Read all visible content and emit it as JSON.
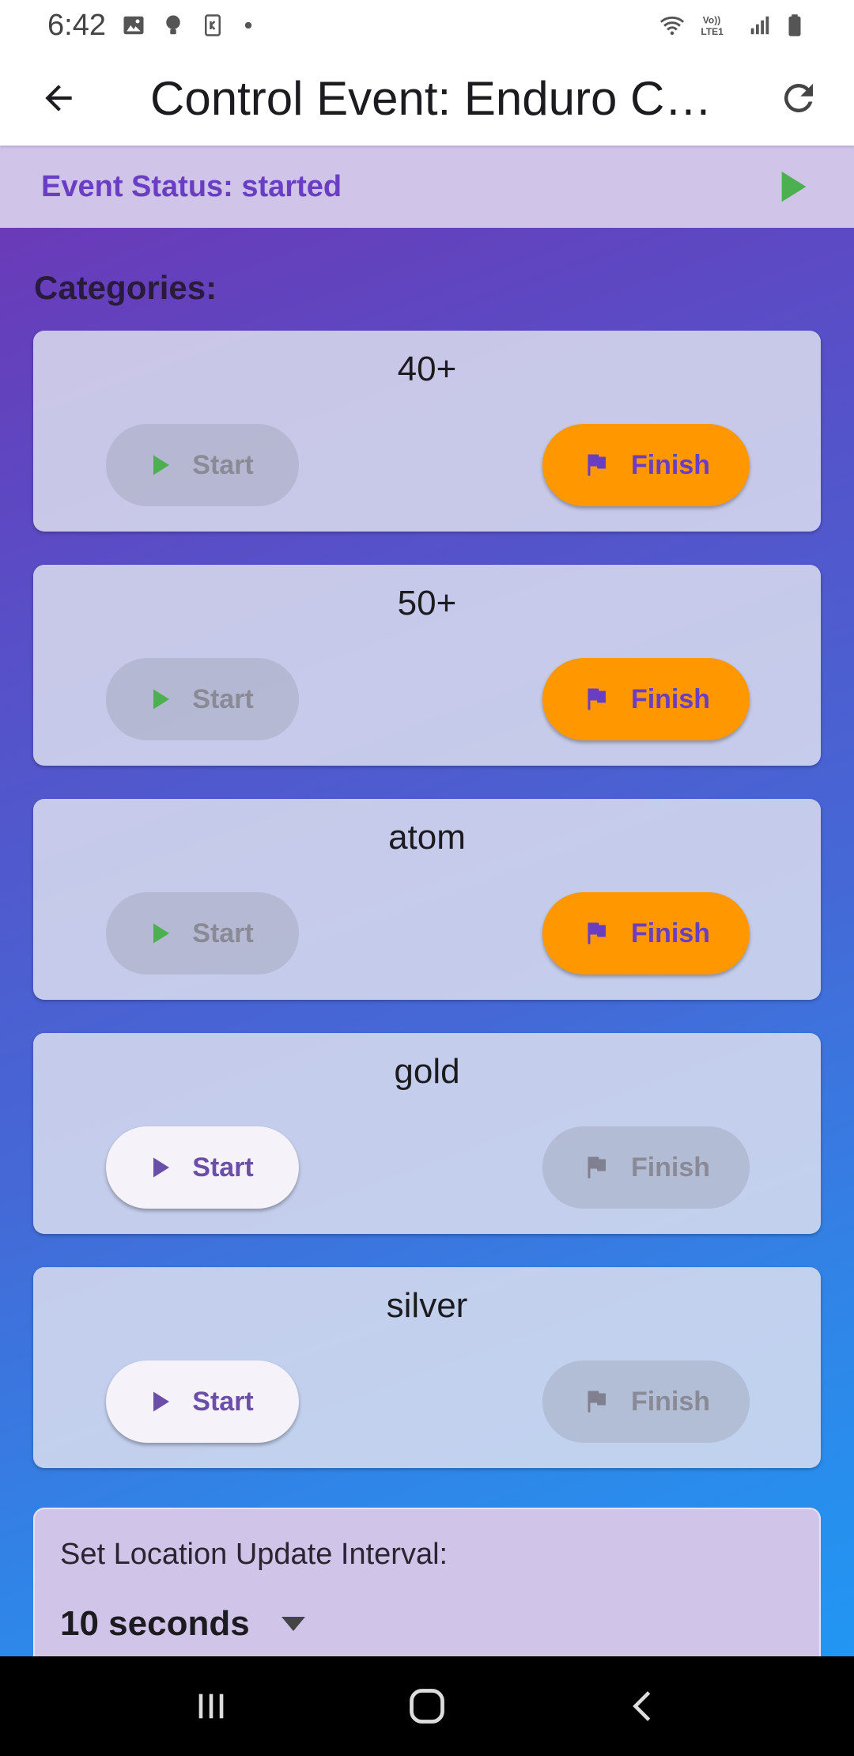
{
  "status_bar": {
    "time": "6:42",
    "icons_left": [
      "image-icon",
      "bulb-icon",
      "k-icon",
      "dot-icon"
    ],
    "icons_right": [
      "wifi-icon",
      "volte-icon",
      "signal-icon",
      "battery-icon"
    ],
    "volte_label": "Vo))\nLTE1"
  },
  "app_bar": {
    "title": "Control Event: Enduro Championship",
    "back_icon": "arrow-left-icon",
    "refresh_icon": "refresh-icon"
  },
  "event_status": {
    "text": "Event Status: started",
    "action_icon": "play-icon",
    "action_color": "#4caf50"
  },
  "categories": {
    "heading": "Categories:",
    "items": [
      {
        "name": "40+",
        "start_label": "Start",
        "finish_label": "Finish",
        "start_enabled": false,
        "finish_enabled": true
      },
      {
        "name": "50+",
        "start_label": "Start",
        "finish_label": "Finish",
        "start_enabled": false,
        "finish_enabled": true
      },
      {
        "name": "atom",
        "start_label": "Start",
        "finish_label": "Finish",
        "start_enabled": false,
        "finish_enabled": true
      },
      {
        "name": "gold",
        "start_label": "Start",
        "finish_label": "Finish",
        "start_enabled": true,
        "finish_enabled": false
      },
      {
        "name": "silver",
        "start_label": "Start",
        "finish_label": "Finish",
        "start_enabled": true,
        "finish_enabled": false
      }
    ]
  },
  "location_interval": {
    "label": "Set Location Update Interval:",
    "selected": "10 seconds"
  },
  "colors": {
    "accent": "#6a3ec2",
    "finish_active": "#ff9800",
    "start_disabled_icon": "#4caf50",
    "event_status_bg": "#d1c4e9"
  },
  "nav_bar": {
    "buttons": [
      "recents-icon",
      "home-icon",
      "back-nav-icon"
    ]
  }
}
